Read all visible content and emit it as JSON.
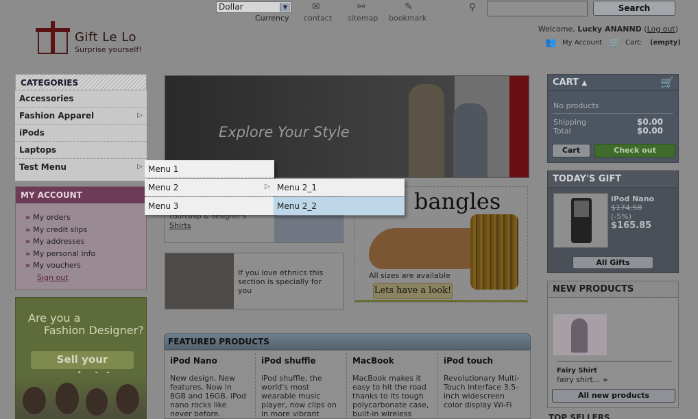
{
  "header": {
    "currency_value": "Dollar",
    "currency_label": "Currency",
    "links": {
      "contact": "contact",
      "sitemap": "sitemap",
      "bookmark": "bookmark"
    },
    "search_button": "Search",
    "search_placeholder": "",
    "welcome_prefix": "Welcome,",
    "user_name": "Lucky ANANND",
    "logout_label": "Log out",
    "my_account": "My Account",
    "cart_label": "Cart:",
    "cart_status": "(empty)"
  },
  "logo": {
    "title": "Gift Le Lo",
    "tagline": "Surprise yourself!"
  },
  "categories": {
    "title": "CATEGORIES",
    "items": [
      "Accessories",
      "Fashion Apparel",
      "iPods",
      "Laptops",
      "Test Menu"
    ]
  },
  "menus": {
    "level1": [
      "Menu 1",
      "Menu 2",
      "Menu 3"
    ],
    "level2": [
      "Menu 2_1",
      "Menu 2_2"
    ]
  },
  "my_account": {
    "title": "MY ACCOUNT",
    "items": [
      "My orders",
      "My credit slips",
      "My addresses",
      "My personal info",
      "My vouchers"
    ],
    "signout": "Sign out"
  },
  "promo": {
    "line1": "Are you a",
    "line2": "Fashion Designer?",
    "cta": "Sell your products!"
  },
  "banner": {
    "text": "Explore Your Style"
  },
  "shirts": {
    "caption": "courtship & designer's",
    "link": "Shirts"
  },
  "ethnic": {
    "text": "If you love ethnics this section is specially for you"
  },
  "bangles": {
    "title": "bangles",
    "sizes": "All sizes are available",
    "cta": "Lets have a look!"
  },
  "featured": {
    "title": "FEATURED PRODUCTS",
    "products": [
      {
        "name": "iPod Nano",
        "desc": "New design. New features. Now in 8GB and 16GB. iPod nano rocks like never before."
      },
      {
        "name": "iPod shuffle",
        "desc": "iPod shuffle, the world's most wearable music player, now clips on in more vibrant"
      },
      {
        "name": "MacBook",
        "desc": "MacBook makes it easy to hit the road thanks to its tough polycarbonate case, built-in wireless"
      },
      {
        "name": "iPod touch",
        "desc": "Revolutionary Multi-Touch interface 3.5-inch widescreen color display Wi-Fi"
      }
    ]
  },
  "cart": {
    "title": "CART",
    "no_products": "No products",
    "shipping_label": "Shipping",
    "shipping_value": "$0.00",
    "total_label": "Total",
    "total_value": "$0.00",
    "cart_button": "Cart",
    "checkout_button": "Check out"
  },
  "todays_gift": {
    "title": "TODAY'S GIFT",
    "name": "iPod Nano",
    "old_price": "$174.58",
    "discount": "(-5%)",
    "price": "$165.85",
    "button": "All Gifts"
  },
  "new_products": {
    "title": "NEW PRODUCTS",
    "name": "Fairy Shirt",
    "desc": "fairy shirt...",
    "button": "All new products"
  },
  "top_sellers": {
    "title": "TOP SELLERS"
  },
  "colors": {
    "highlight": "#bdd7e8",
    "cart_bg": "#4d5560",
    "checkout": "#3f6c2a"
  }
}
